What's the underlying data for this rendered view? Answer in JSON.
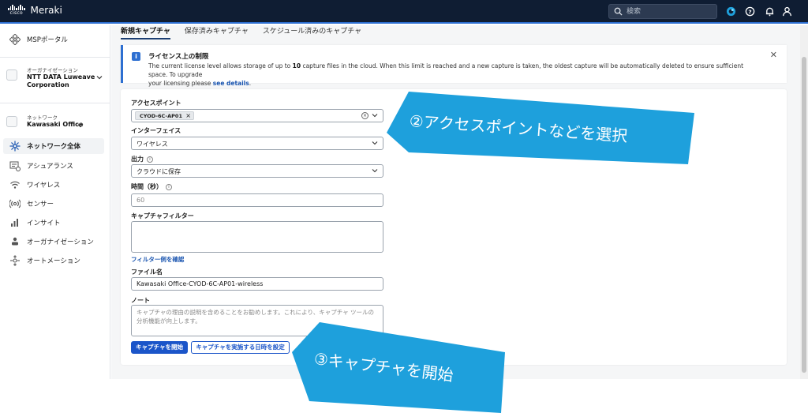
{
  "app": {
    "logo_text": "cisco",
    "name": "Meraki"
  },
  "search": {
    "placeholder": "検索"
  },
  "sidebar": {
    "msp": "MSPポータル",
    "org_small": "オーガナイゼーション",
    "org_name_1": "NTT DATA Luweave",
    "org_name_2": "Corporation",
    "net_small": "ネットワーク",
    "net_name": "Kawasaki Office",
    "items": [
      {
        "label": "ネットワーク全体",
        "icon": "network-wide-icon"
      },
      {
        "label": "アシュアランス",
        "icon": "assurance-icon"
      },
      {
        "label": "ワイヤレス",
        "icon": "wifi-icon"
      },
      {
        "label": "センサー",
        "icon": "sensor-icon"
      },
      {
        "label": "インサイト",
        "icon": "insight-icon"
      },
      {
        "label": "オーガナイゼーション",
        "icon": "organization-icon"
      },
      {
        "label": "オートメーション",
        "icon": "automation-icon"
      }
    ]
  },
  "tabs": [
    {
      "label": "新規キャプチャ",
      "active": true
    },
    {
      "label": "保存済みキャプチャ",
      "active": false
    },
    {
      "label": "スケジュール済みのキャプチャ",
      "active": false
    }
  ],
  "notice": {
    "title": "ライセンス上の制限",
    "body_1": "The current license level allows storage of up to ",
    "body_count": "10",
    "body_2": " capture files in the cloud. When this limit is reached and a new capture is taken, the oldest capture will be automatically deleted to ensure sufficient space. To upgrade",
    "body_3": "your licensing please ",
    "link": "see details",
    "body_4": "."
  },
  "form": {
    "ap_label": "アクセスポイント",
    "ap_chip": "CYOD-6C-AP01",
    "interface_label": "インターフェイス",
    "interface_value": "ワイヤレス",
    "output_label": "出力",
    "output_value": "クラウドに保存",
    "duration_label": "時間（秒）",
    "duration_placeholder": "60",
    "filter_label": "キャプチャフィルター",
    "filter_link": "フィルター例を確認",
    "filename_label": "ファイル名",
    "filename_value": "Kawasaki Office-CYOD-6C-AP01-wireless",
    "note_label": "ノート",
    "note_placeholder": "キャプチャの理由の説明を含めることをお勧めします。これにより、キャプチャ ツールの分析機能が向上します。",
    "start_button": "キャプチャを開始",
    "schedule_button": "キャプチャを実施する日時を設定"
  },
  "callouts": {
    "step2": "②アクセスポイントなどを選択",
    "step3": "③キャプチャを開始",
    "color": "#1ea0dc"
  }
}
